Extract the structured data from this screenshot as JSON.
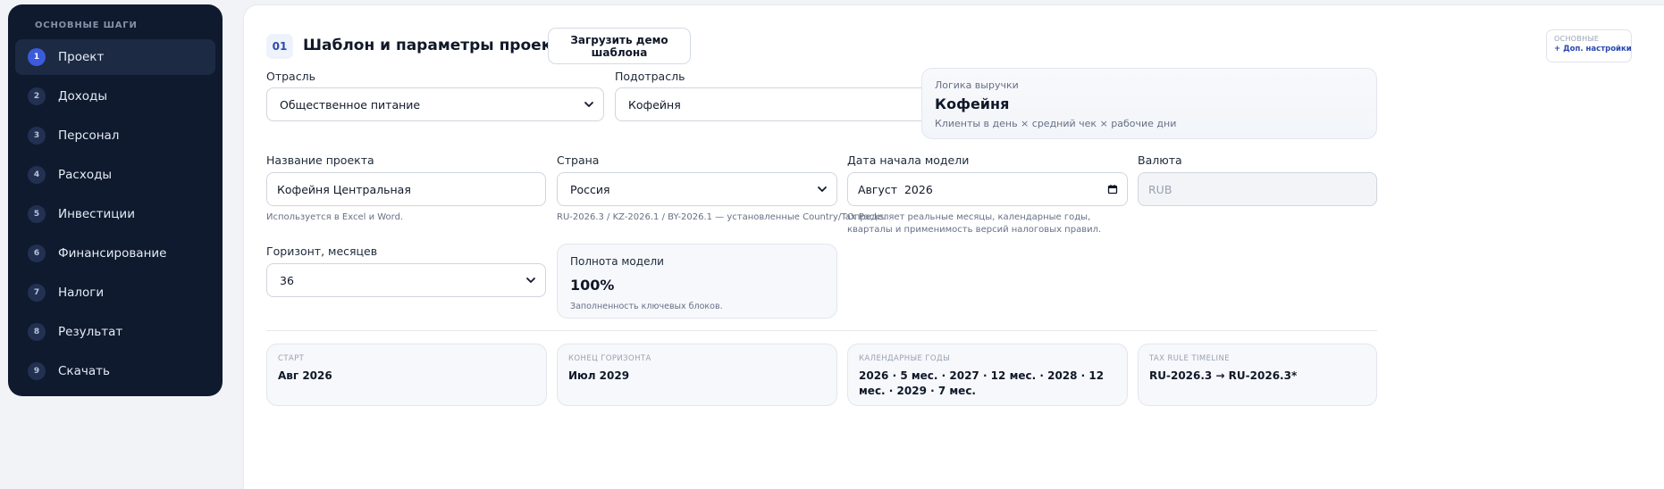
{
  "sidebar": {
    "heading": "ОСНОВНЫЕ ШАГИ",
    "items": [
      {
        "num": "1",
        "label": "Проект"
      },
      {
        "num": "2",
        "label": "Доходы"
      },
      {
        "num": "3",
        "label": "Персонал"
      },
      {
        "num": "4",
        "label": "Расходы"
      },
      {
        "num": "5",
        "label": "Инвестиции"
      },
      {
        "num": "6",
        "label": "Финансирование"
      },
      {
        "num": "7",
        "label": "Налоги"
      },
      {
        "num": "8",
        "label": "Результат"
      },
      {
        "num": "9",
        "label": "Скачать"
      }
    ]
  },
  "header": {
    "step": "01",
    "title": "Шаблон и параметры проекта",
    "demo_button": "Загрузить демо шаблона",
    "mode_main": "ОСНОВНЫЕ",
    "mode_extra": "+ Доп. настройки"
  },
  "form": {
    "industry_label": "Отрасль",
    "industry_value": "Общественное питание",
    "subindustry_label": "Подотрасль",
    "subindustry_value": "Кофейня",
    "project_name_label": "Название проекта",
    "project_name_value": "Кофейня Центральная",
    "project_name_hint": "Используется в Excel и Word.",
    "country_label": "Страна",
    "country_value": "Россия",
    "country_hint": "RU-2026.3 / KZ-2026.1 / BY-2026.1 — установленные Country/Tax Packs.",
    "start_date_label": "Дата начала модели",
    "start_date_value": "Август  2026",
    "start_date_hint": "Определяет реальные месяцы, календарные годы, кварталы и применимость версий налоговых правил.",
    "currency_label": "Валюта",
    "currency_value": "RUB",
    "horizon_label": "Горизонт, месяцев",
    "horizon_value": "36"
  },
  "revenue_logic": {
    "caption": "Логика выручки",
    "value": "Кофейня",
    "formula": "Клиенты в день × средний чек × рабочие дни"
  },
  "completeness": {
    "title": "Полнота модели",
    "value": "100%",
    "note": "Заполненность ключевых блоков."
  },
  "timeline": [
    {
      "caption": "СТАРТ",
      "value": "Авг 2026"
    },
    {
      "caption": "КОНЕЦ ГОРИЗОНТА",
      "value": "Июл 2029"
    },
    {
      "caption": "КАЛЕНДАРНЫЕ ГОДЫ",
      "value": "2026 · 5 мес. · 2027 · 12 мес. · 2028 · 12 мес. · 2029 · 7 мес."
    },
    {
      "caption": "TAX RULE TIMELINE",
      "value": "RU-2026.3 → RU-2026.3*"
    }
  ]
}
